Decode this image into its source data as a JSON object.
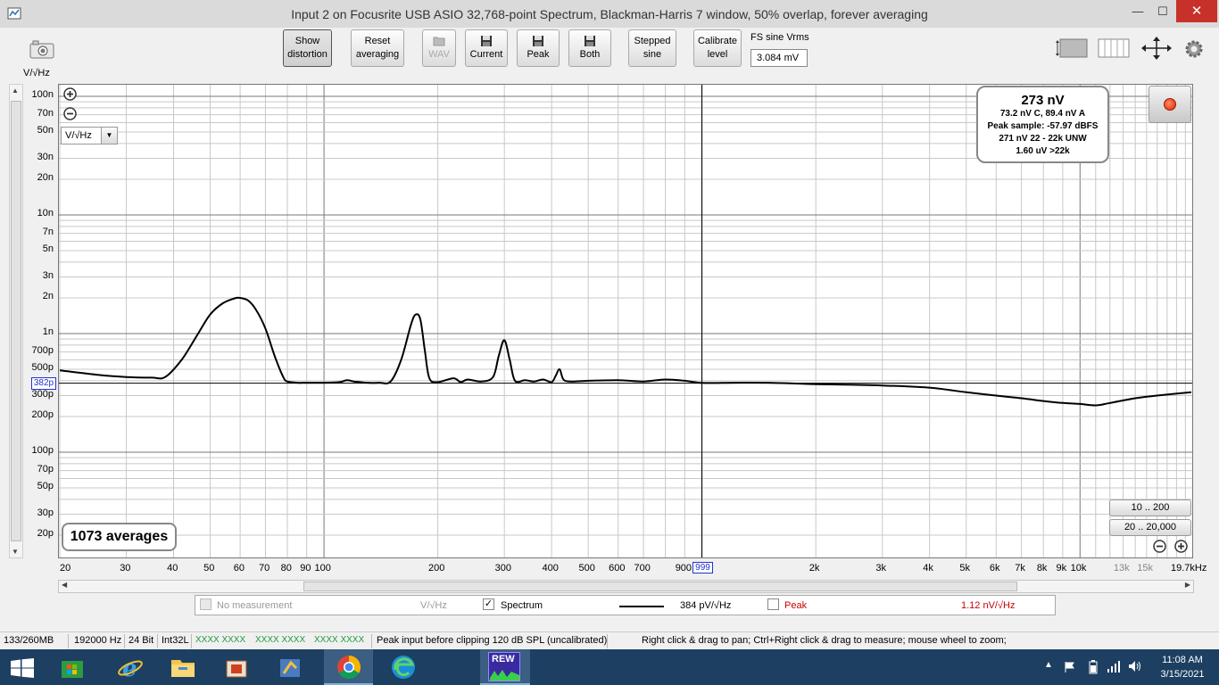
{
  "window": {
    "title": "Input 2 on Focusrite USB ASIO 32,768-point Spectrum, Blackman-Harris 7 window, 50% overlap, forever averaging",
    "minimize": "—",
    "maximize": "☐",
    "close": "✕"
  },
  "toolbar": {
    "show_distortion": [
      "Show",
      "distortion"
    ],
    "reset_averaging": [
      "Reset",
      "averaging"
    ],
    "wav": "WAV",
    "current": "Current",
    "peak": "Peak",
    "both": "Both",
    "stepped_sine": [
      "Stepped",
      "sine"
    ],
    "calibrate_level": [
      "Calibrate",
      "level"
    ],
    "fs_label": "FS sine Vrms",
    "fs_value": "3.084 mV"
  },
  "graph": {
    "y_unit_label": "V/√Hz",
    "unit_selector": "V/√Hz",
    "y_tick_labels": [
      "100n",
      "70n",
      "50n",
      "30n",
      "20n",
      "10n",
      "7n",
      "5n",
      "3n",
      "2n",
      "1n",
      "700p",
      "500p",
      "300p",
      "200p",
      "100p",
      "70p",
      "50p",
      "30p",
      "20p"
    ],
    "x_tick_labels": [
      "20",
      "30",
      "40",
      "50",
      "60",
      "70",
      "80",
      "90",
      "100",
      "200",
      "300",
      "400",
      "500",
      "600",
      "700",
      "900",
      "2k",
      "3k",
      "4k",
      "5k",
      "6k",
      "7k",
      "8k",
      "9k",
      "10k",
      "13k",
      "15k",
      "19.7kHz"
    ],
    "x_tick_grey": [
      "13k",
      "15k"
    ],
    "cursor_y_value": "382p",
    "cursor_x_value": "999",
    "averages": "1073 averages",
    "range_buttons": [
      "10 .. 200",
      "20 .. 20,000"
    ],
    "info": {
      "main": "273 nV",
      "line1": "73.2 nV C, 89.4 nV A",
      "line2": "Peak sample: -57.97 dBFS",
      "line3": "271 nV 22 - 22k UNW",
      "line4": "1.60 uV >22k"
    },
    "trace_color": "#000000",
    "cursor_color": "#000000"
  },
  "chart_data": {
    "type": "line",
    "title": "",
    "xlabel": "",
    "ylabel": "V/√Hz",
    "x_scale": "log",
    "y_scale": "log",
    "xlim": [
      20,
      19700
    ],
    "ylim_volts_per_rtHz": [
      1.4e-11,
      1.3e-07
    ],
    "series": [
      {
        "name": "Spectrum",
        "x": [
          20,
          25,
          30,
          35,
          38,
          42,
          46,
          50,
          54,
          58,
          60,
          63,
          66,
          70,
          74,
          78,
          80,
          85,
          90,
          100,
          110,
          115,
          120,
          130,
          140,
          150,
          160,
          170,
          175,
          180,
          185,
          190,
          200,
          220,
          230,
          240,
          260,
          280,
          290,
          300,
          310,
          320,
          340,
          360,
          380,
          400,
          410,
          420,
          430,
          450,
          500,
          600,
          700,
          800,
          900,
          999,
          1200,
          1500,
          2000,
          2500,
          3000,
          4000,
          5000,
          6000,
          7000,
          8000,
          9000,
          10000,
          11000,
          12000,
          14000,
          16000,
          19700
        ],
        "values": [
          4.9e-10,
          4.5e-10,
          4.3e-10,
          4.25e-10,
          4.3e-10,
          6e-10,
          9.5e-10,
          1.45e-09,
          1.8e-09,
          1.98e-09,
          2e-09,
          1.9e-09,
          1.6e-09,
          1.1e-09,
          6.5e-10,
          4.3e-10,
          3.95e-10,
          3.85e-10,
          3.85e-10,
          3.85e-10,
          3.9e-10,
          4.05e-10,
          3.95e-10,
          3.85e-10,
          3.85e-10,
          3.95e-10,
          6e-10,
          1.2e-09,
          1.45e-09,
          1.3e-09,
          7e-10,
          4.2e-10,
          3.9e-10,
          4.2e-10,
          3.9e-10,
          4.1e-10,
          3.95e-10,
          4.3e-10,
          6.5e-10,
          8.8e-10,
          6e-10,
          4e-10,
          4.05e-10,
          3.95e-10,
          4.1e-10,
          3.9e-10,
          4.4e-10,
          5e-10,
          4.1e-10,
          3.95e-10,
          4e-10,
          4.05e-10,
          3.95e-10,
          4.1e-10,
          4e-10,
          3.84e-10,
          3.85e-10,
          3.85e-10,
          3.75e-10,
          3.7e-10,
          3.65e-10,
          3.5e-10,
          3.2e-10,
          3e-10,
          2.85e-10,
          2.7e-10,
          2.6e-10,
          2.55e-10,
          2.48e-10,
          2.6e-10,
          2.85e-10,
          3e-10,
          3.2e-10
        ]
      }
    ]
  },
  "legend": {
    "no_measurement": "No measurement",
    "no_measurement_unit": "V/√Hz",
    "spectrum_label": "Spectrum",
    "spectrum_value": "384 pV/√Hz",
    "peak_label": "Peak",
    "peak_value": "1.12 nV/√Hz",
    "peak_color": "#cc0000",
    "check": "✓"
  },
  "statusbar": {
    "memory": "133/260MB",
    "rate": "192000 Hz",
    "bits": "24 Bit",
    "format": "Int32L",
    "meters": [
      "XXXX XXXX",
      "XXXX XXXX",
      "XXXX XXXX"
    ],
    "peak_input": "Peak input before clipping 120 dB SPL (uncalibrated)",
    "hint": "Right click & drag to pan; Ctrl+Right click & drag to measure; mouse wheel to zoom;"
  },
  "taskbar": {
    "time": "11:08 AM",
    "date": "3/15/2021",
    "rew_label": "REW"
  }
}
